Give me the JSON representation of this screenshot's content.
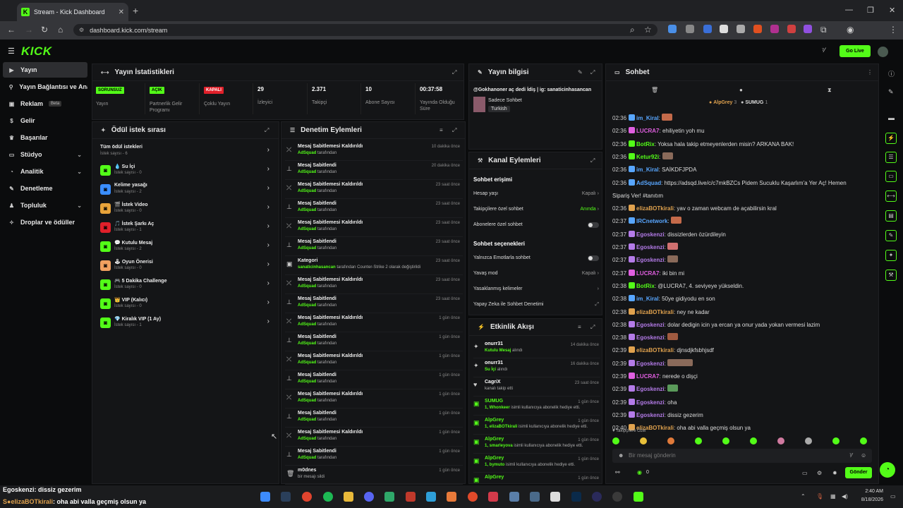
{
  "browser": {
    "tab_title": "Stream - Kick Dashboard",
    "url": "dashboard.kick.com/stream"
  },
  "header": {
    "logo": "KICK",
    "golive": "Go Live"
  },
  "sidebar": {
    "items": [
      {
        "label": "Yayın",
        "icon": "video-icon"
      },
      {
        "label": "Yayın Bağlantısı ve Anahtarı",
        "icon": "key-icon"
      },
      {
        "label": "Reklam",
        "beta": "Beta",
        "icon": "ad-icon"
      },
      {
        "label": "Gelir",
        "icon": "money-icon"
      },
      {
        "label": "Başarılar",
        "icon": "trophy-icon"
      },
      {
        "label": "Stüdyo",
        "icon": "studio-icon"
      },
      {
        "label": "Analitik",
        "icon": "chart-icon"
      },
      {
        "label": "Denetleme",
        "icon": "shield-icon"
      },
      {
        "label": "Topluluk",
        "icon": "people-icon"
      },
      {
        "label": "Droplar ve ödüller",
        "icon": "gift-icon"
      }
    ]
  },
  "stats": {
    "title": "Yayın İstatistikleri",
    "items": [
      {
        "badge": "SORUNSUZ",
        "label": "Yayın"
      },
      {
        "badge": "AÇIK",
        "label": "Partnerlik Gelir Programı"
      },
      {
        "badge": "KAPALI",
        "label": "Çoklu Yayın"
      },
      {
        "value": "29",
        "label": "İzleyici"
      },
      {
        "value": "2.371",
        "label": "Takipçi"
      },
      {
        "value": "10",
        "label": "Abone Sayısı"
      },
      {
        "value": "00:37:58",
        "label": "Yayında Olduğu Süre"
      }
    ]
  },
  "queue": {
    "title": "Ödül istek sırası",
    "items": [
      {
        "name": "Tüm ödül istekleri",
        "sub": "İstek sayısı - 6"
      },
      {
        "name": "💧 Su İçi",
        "sub": "İstek sayısı - 0"
      },
      {
        "name": "Kelime yasağı",
        "sub": "İstek sayısı - 2"
      },
      {
        "name": "🎬 İstek Video",
        "sub": "İstek sayısı - 0"
      },
      {
        "name": "🎵 İstek Şarkı Aç",
        "sub": "İstek sayısı - 1"
      },
      {
        "name": "💬 Kutulu Mesaj",
        "sub": "İstek sayısı - 2"
      },
      {
        "name": "🕹 Oyun Önerisi",
        "sub": "İstek sayısı - 0"
      },
      {
        "name": "🎮 5 Dakika Challenge",
        "sub": "İstek sayısı - 0"
      },
      {
        "name": "👑 VIP (Kalıcı)",
        "sub": "İstek sayısı - 0"
      },
      {
        "name": "💎 Kiralık VIP (1 Ay)",
        "sub": "İstek sayısı - 1"
      }
    ]
  },
  "moderation": {
    "title": "Denetim Eylemleri",
    "items": [
      {
        "title": "Mesaj Sabitlemesi Kaldırıldı",
        "user": "AdSquad",
        "suffix": "tarafından",
        "time": "10 dakika önce"
      },
      {
        "title": "Mesaj Sabitlendi",
        "user": "AdSquad",
        "suffix": "tarafından",
        "time": "20 dakika önce"
      },
      {
        "title": "Mesaj Sabitlemesi Kaldırıldı",
        "user": "AdSquad",
        "suffix": "tarafından",
        "time": "23 saat önce"
      },
      {
        "title": "Mesaj Sabitlendi",
        "user": "AdSquad",
        "suffix": "tarafından",
        "time": "23 saat önce"
      },
      {
        "title": "Mesaj Sabitlemesi Kaldırıldı",
        "user": "AdSquad",
        "suffix": "tarafından",
        "time": "23 saat önce"
      },
      {
        "title": "Mesaj Sabitlendi",
        "user": "AdSquad",
        "suffix": "tarafından",
        "time": "23 saat önce"
      },
      {
        "title": "Kategori",
        "user": "sanaticinhasancan",
        "suffix": "tarafından Counter-Strike 2 olarak değiştirildi",
        "time": "23 saat önce"
      },
      {
        "title": "Mesaj Sabitlemesi Kaldırıldı",
        "user": "AdSquad",
        "suffix": "tarafından",
        "time": "23 saat önce"
      },
      {
        "title": "Mesaj Sabitlendi",
        "user": "AdSquad",
        "suffix": "tarafından",
        "time": "23 saat önce"
      },
      {
        "title": "Mesaj Sabitlemesi Kaldırıldı",
        "user": "AdSquad",
        "suffix": "tarafından",
        "time": "1 gün önce"
      },
      {
        "title": "Mesaj Sabitlendi",
        "user": "AdSquad",
        "suffix": "tarafından",
        "time": "1 gün önce"
      },
      {
        "title": "Mesaj Sabitlemesi Kaldırıldı",
        "user": "AdSquad",
        "suffix": "tarafından",
        "time": "1 gün önce"
      },
      {
        "title": "Mesaj Sabitlendi",
        "user": "AdSquad",
        "suffix": "tarafından",
        "time": "1 gün önce"
      },
      {
        "title": "Mesaj Sabitlemesi Kaldırıldı",
        "user": "AdSquad",
        "suffix": "tarafından",
        "time": "1 gün önce"
      },
      {
        "title": "Mesaj Sabitlendi",
        "user": "AdSquad",
        "suffix": "tarafından",
        "time": "1 gün önce"
      },
      {
        "title": "Mesaj Sabitlemesi Kaldırıldı",
        "user": "AdSquad",
        "suffix": "tarafından",
        "time": "1 gün önce"
      },
      {
        "title": "Mesaj Sabitlendi",
        "user": "AdSquad",
        "suffix": "tarafından",
        "time": "1 gün önce"
      },
      {
        "title": "m0dnes",
        "user": "",
        "suffix": "bir mesajı sildi",
        "time": "1 gün önce"
      }
    ]
  },
  "streaminfo": {
    "title": "Yayın bilgisi",
    "desc": "@Gokhanoner aç dedi İdiş | ig: sanaticinhasancan",
    "category": "Sadece Sohbet",
    "tag": "Turkish"
  },
  "channel": {
    "title": "Kanal Eylemleri",
    "sec1": "Sohbet erişimi",
    "rows1": [
      {
        "label": "Hesap yaşı",
        "value": "Kapalı"
      },
      {
        "label": "Takipçilere özel sohbet",
        "value": "Anında"
      },
      {
        "label": "Abonelere özel sohbet",
        "value": ""
      }
    ],
    "sec2": "Sohbet seçenekleri",
    "rows2": [
      {
        "label": "Yalnızca Emotlarla sohbet",
        "value": ""
      },
      {
        "label": "Yavaş mod",
        "value": "Kapalı"
      },
      {
        "label": "Yasaklanmış kelimeler",
        "value": ""
      },
      {
        "label": "Yapay Zeka ile Sohbet Denetimi",
        "value": ""
      }
    ]
  },
  "activity": {
    "title": "Etkinlik Akışı",
    "items": [
      {
        "name": "onurr31",
        "sub": "Kutulu Mesaj",
        "suffix": "alındı",
        "time": "14 dakika önce"
      },
      {
        "name": "onurr31",
        "sub": "Su İçi",
        "suffix": "alındı",
        "time": "16 dakika önce"
      },
      {
        "name": "CagriX",
        "sub": "",
        "suffix": "kanalı takip etti",
        "time": "23 saat önce"
      },
      {
        "name": "SUMUG",
        "sub": "1, Whonkeer",
        "suffix": "isimli kullanıcıya abonelik hediye etti.",
        "time": "1 gün önce"
      },
      {
        "name": "AlpGrey",
        "sub": "1, elizaBOTkirali",
        "suffix": "isimli kullanıcıya abonelik hediye etti.",
        "time": "1 gün önce"
      },
      {
        "name": "AlpGrey",
        "sub": "1, smarleyova",
        "suffix": "isimli kullanıcıya abonelik hediye etti.",
        "time": "1 gün önce"
      },
      {
        "name": "AlpGrey",
        "sub": "1, bymuto",
        "suffix": "isimli kullanıcıya abonelik hediye etti.",
        "time": "1 gün önce"
      },
      {
        "name": "AlpGrey",
        "sub": "",
        "suffix": "",
        "time": "1 gün önce"
      }
    ]
  },
  "chat": {
    "title": "Sohbet",
    "top": [
      "AlpGrey",
      "3",
      "SUMUG",
      "1"
    ],
    "messages": [
      {
        "t": "02:36",
        "u": "im_Kiral",
        "c": "#58a6ff",
        "m": ""
      },
      {
        "t": "02:36",
        "u": "LUCRA7",
        "c": "#e05fe0",
        "m": "ehiliyetin yoh mu"
      },
      {
        "t": "02:36",
        "u": "BotRix",
        "c": "#53fc18",
        "m": "Yoksa hala takip etmeyenlerden misin? ARKANA BAK!"
      },
      {
        "t": "02:36",
        "u": "Ketur92i",
        "c": "#53fc18",
        "m": ""
      },
      {
        "t": "02:36",
        "u": "im_Kiral",
        "c": "#58a6ff",
        "m": "SAİKDFJPDA"
      },
      {
        "t": "02:36",
        "u": "AdSquad",
        "c": "#58a6ff",
        "m": "https://adsqd.live/c/c7mkBZCs Pidem Sucuklu Kaşarlım'a Yer Aç! Hemen"
      },
      {
        "t": "",
        "u": "",
        "c": "#ddd",
        "m": "Sipariş Ver! #tanıtım"
      },
      {
        "t": "02:36",
        "u": "elizaBOTkirali",
        "c": "#e0a24e",
        "m": "yav o zaman webcam de açabilirsin kral"
      },
      {
        "t": "02:37",
        "u": "IRCnetwork",
        "c": "#58a6ff",
        "m": ""
      },
      {
        "t": "02:37",
        "u": "Egoskenzi",
        "c": "#b47be8",
        "m": "dissizlerden özürdileyin"
      },
      {
        "t": "02:37",
        "u": "Egoskenzi",
        "c": "#b47be8",
        "m": ""
      },
      {
        "t": "02:37",
        "u": "Egoskenzi",
        "c": "#b47be8",
        "m": ""
      },
      {
        "t": "02:37",
        "u": "LUCRA7",
        "c": "#e05fe0",
        "m": "iki bin mi"
      },
      {
        "t": "02:38",
        "u": "BotRix",
        "c": "#53fc18",
        "m": "@LUCRA7, 4. seviyeye yükseldin."
      },
      {
        "t": "02:38",
        "u": "im_Kiral",
        "c": "#58a6ff",
        "m": "50ye gidiyodu en son"
      },
      {
        "t": "02:38",
        "u": "elizaBOTkirali",
        "c": "#e0a24e",
        "m": "ney ne kadar"
      },
      {
        "t": "02:38",
        "u": "Egoskenzi",
        "c": "#b47be8",
        "m": "dolar dedigin icin ya ercan ya onur yada yokan vermesi lazim"
      },
      {
        "t": "02:38",
        "u": "Egoskenzi",
        "c": "#b47be8",
        "m": ""
      },
      {
        "t": "02:39",
        "u": "elizaBOTkirali",
        "c": "#e0a24e",
        "m": "djnsdjkfsbhjsdf"
      },
      {
        "t": "02:39",
        "u": "Egoskenzi",
        "c": "#b47be8",
        "m": ""
      },
      {
        "t": "02:39",
        "u": "LUCRA7",
        "c": "#e05fe0",
        "m": "nerede o dişçi"
      },
      {
        "t": "02:39",
        "u": "Egoskenzi",
        "c": "#b47be8",
        "m": ""
      },
      {
        "t": "02:39",
        "u": "Egoskenzi",
        "c": "#b47be8",
        "m": "oha"
      },
      {
        "t": "02:39",
        "u": "Egoskenzi",
        "c": "#b47be8",
        "m": "dissiz gezerim"
      },
      {
        "t": "02:40",
        "u": "elizaBOTkirali",
        "c": "#e0a24e",
        "m": "oha abi valla geçmiş olsun ya"
      }
    ],
    "followers_only": "Takipçilere Özel",
    "placeholder": "Bir mesaj gönderin",
    "send": "Gönder",
    "count": "0"
  },
  "overlay": {
    "line1_user": "Egoskenzi",
    "line1_msg": ": dissiz gezerim",
    "line2_user": "elizaBOTkirali",
    "line2_msg": ": oha abi valla geçmiş olsun ya"
  },
  "taskbar": {
    "time": "2:40 AM",
    "date": "8/18/2026"
  }
}
